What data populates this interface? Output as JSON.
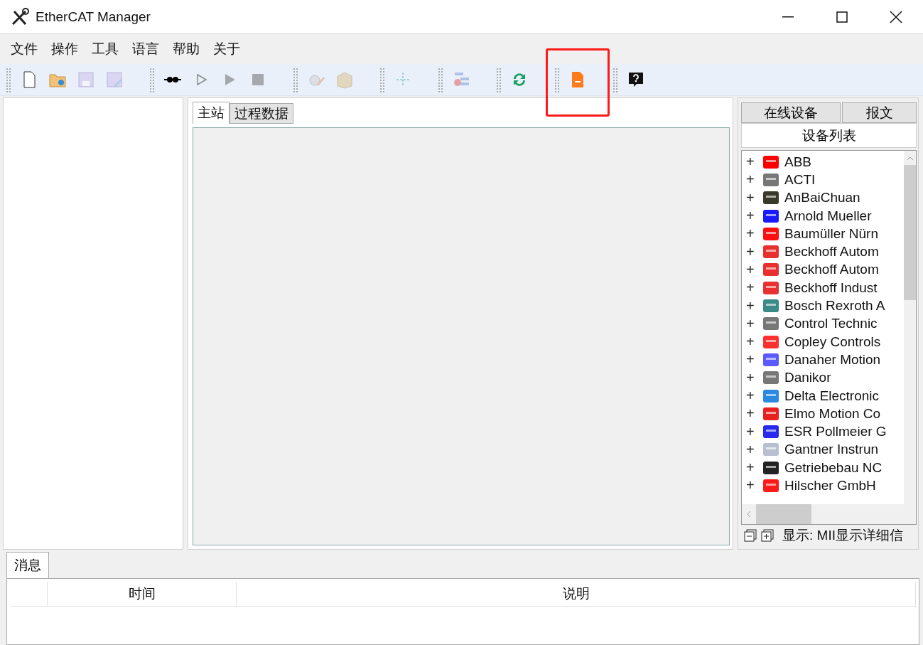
{
  "window": {
    "title": "EtherCAT Manager"
  },
  "menu": [
    "文件",
    "操作",
    "工具",
    "语言",
    "帮助",
    "关于"
  ],
  "toolbar": [
    {
      "items": [
        {
          "kind": "new",
          "disabled": false
        },
        {
          "kind": "open",
          "disabled": false
        },
        {
          "kind": "save",
          "disabled": true
        },
        {
          "kind": "save-as",
          "disabled": true
        }
      ]
    },
    {
      "items": [
        {
          "kind": "connect",
          "disabled": false
        },
        {
          "kind": "play-outline",
          "disabled": false
        },
        {
          "kind": "play",
          "disabled": true
        },
        {
          "kind": "stop",
          "disabled": true
        }
      ]
    },
    {
      "items": [
        {
          "kind": "gear",
          "disabled": true
        },
        {
          "kind": "package",
          "disabled": true
        }
      ]
    },
    {
      "items": [
        {
          "kind": "tree",
          "disabled": true
        }
      ]
    },
    {
      "items": [
        {
          "kind": "list",
          "disabled": true
        }
      ]
    },
    {
      "items": [
        {
          "kind": "refresh",
          "disabled": false
        }
      ]
    },
    {
      "items": [
        {
          "kind": "file",
          "disabled": false,
          "highlighted": true
        }
      ]
    },
    {
      "items": [
        {
          "kind": "help",
          "disabled": false
        }
      ]
    }
  ],
  "center_tabs": [
    {
      "label": "主站",
      "selected": true
    },
    {
      "label": "过程数据",
      "selected": false
    }
  ],
  "right_tabs": [
    {
      "label": "在线设备",
      "selected": false
    },
    {
      "label": "报文",
      "selected": false
    }
  ],
  "device_list": {
    "title": "设备列表",
    "items": [
      {
        "expander": "+",
        "name": "ABB",
        "color": "#ff0000"
      },
      {
        "expander": "+",
        "name": "ACTI",
        "color": "#777777"
      },
      {
        "expander": "+",
        "name": "AnBaiChuan",
        "color": "#3a3a2a"
      },
      {
        "expander": "+",
        "name": "Arnold Mueller",
        "color": "#1a1aff"
      },
      {
        "expander": "+",
        "name": "Baumüller Nürn",
        "color": "#ff1010"
      },
      {
        "expander": "+",
        "name": "Beckhoff Autom",
        "color": "#e83030"
      },
      {
        "expander": "+",
        "name": "Beckhoff Autom",
        "color": "#e83030"
      },
      {
        "expander": "+",
        "name": "Beckhoff Indust",
        "color": "#e83030"
      },
      {
        "expander": "+",
        "name": "Bosch Rexroth A",
        "color": "#3a8a8a"
      },
      {
        "expander": "+",
        "name": "Control Technic",
        "color": "#777777"
      },
      {
        "expander": "+",
        "name": "Copley Controls",
        "color": "#ff3030"
      },
      {
        "expander": "+",
        "name": "Danaher Motion",
        "color": "#5a5aff"
      },
      {
        "expander": "+",
        "name": "Danikor",
        "color": "#777777"
      },
      {
        "expander": "+",
        "name": "Delta Electronic",
        "color": "#2a8adf"
      },
      {
        "expander": "+",
        "name": "Elmo Motion Co",
        "color": "#e82020"
      },
      {
        "expander": "+",
        "name": "ESR Pollmeier G",
        "color": "#2a2aef"
      },
      {
        "expander": "+",
        "name": "Gantner Instrun",
        "color": "#b8c0d0"
      },
      {
        "expander": "+",
        "name": "Getriebebau NC",
        "color": "#222222"
      },
      {
        "expander": "+",
        "name": "Hilscher GmbH",
        "color": "#ff1a1a"
      }
    ]
  },
  "device_footer": {
    "text": "显示: MII显示详细信"
  },
  "bottom_tabs": [
    {
      "label": "消息",
      "selected": true
    }
  ],
  "message_table": {
    "columns": [
      "时间",
      "说明"
    ]
  }
}
